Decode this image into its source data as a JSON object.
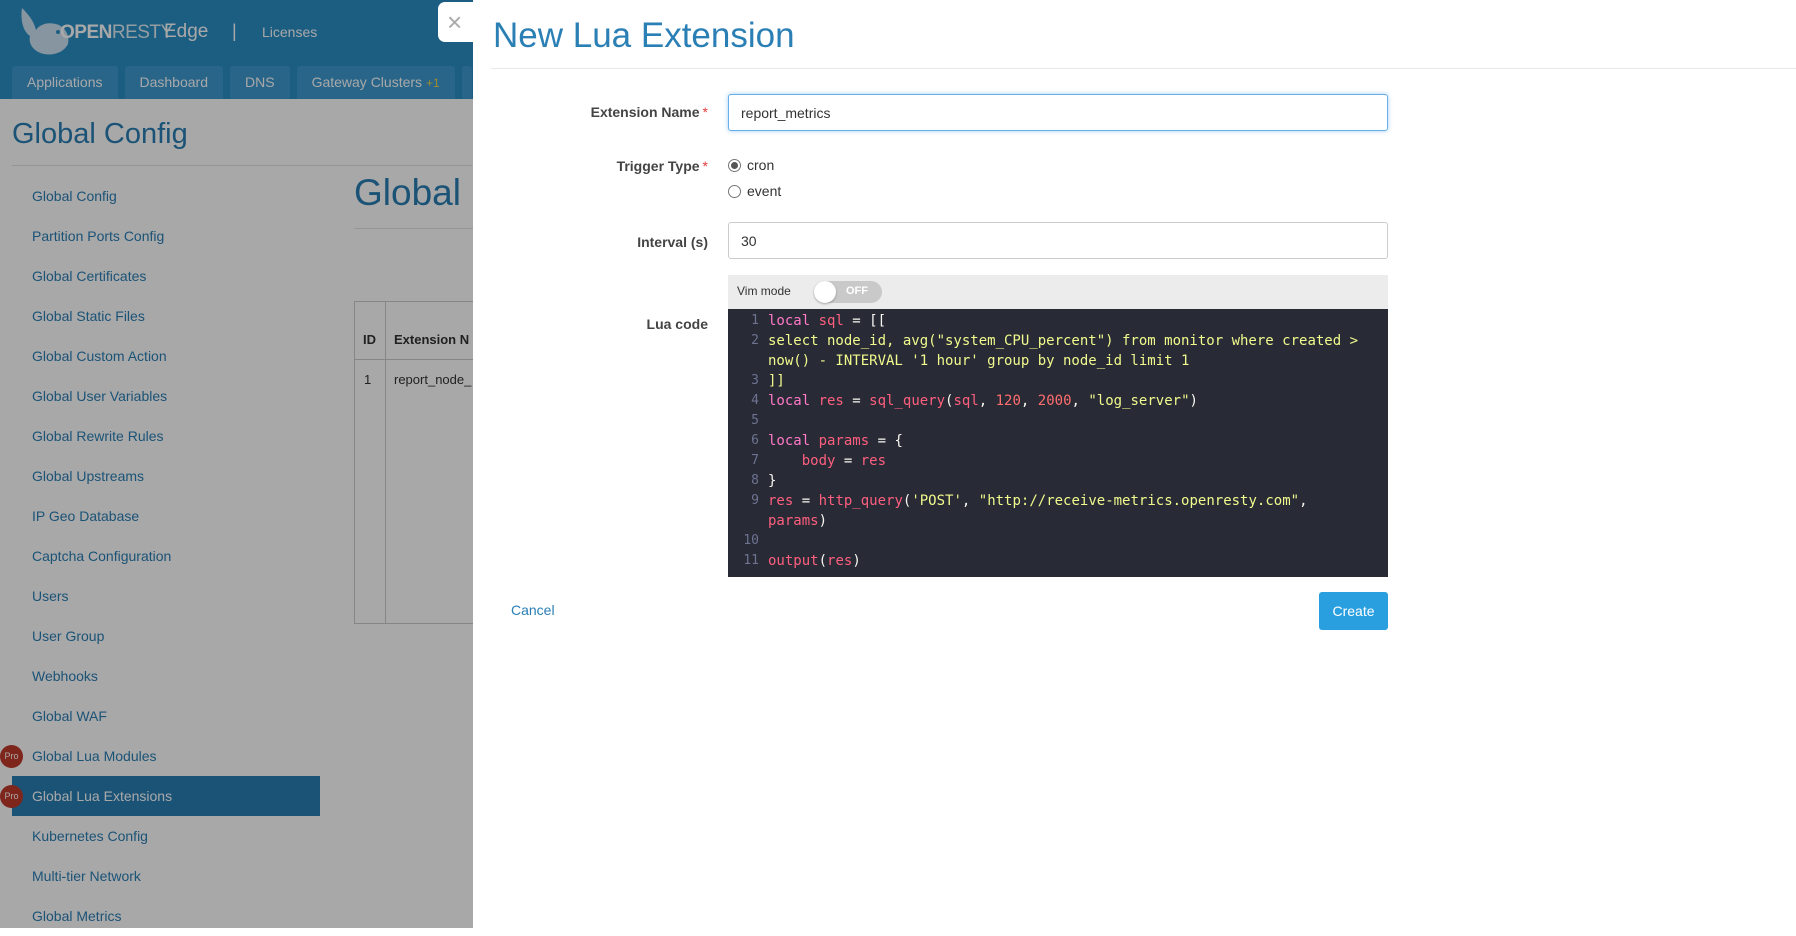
{
  "header": {
    "logo_bold": "OPEN",
    "logo_light": "RESTY",
    "product": "Edge",
    "separator": "|",
    "licenses_link": "Licenses"
  },
  "nav": {
    "tabs": [
      {
        "label": "Applications"
      },
      {
        "label": "Dashboard"
      },
      {
        "label": "DNS"
      },
      {
        "label": "Gateway Clusters",
        "badge": "+1"
      }
    ]
  },
  "page": {
    "title": "Global Config",
    "main_title": "Global L"
  },
  "sidebar": {
    "items": [
      {
        "label": "Global Config"
      },
      {
        "label": "Partition Ports Config"
      },
      {
        "label": "Global Certificates"
      },
      {
        "label": "Global Static Files"
      },
      {
        "label": "Global Custom Action"
      },
      {
        "label": "Global User Variables"
      },
      {
        "label": "Global Rewrite Rules"
      },
      {
        "label": "Global Upstreams"
      },
      {
        "label": "IP Geo Database"
      },
      {
        "label": "Captcha Configuration"
      },
      {
        "label": "Users"
      },
      {
        "label": "User Group"
      },
      {
        "label": "Webhooks"
      },
      {
        "label": "Global WAF"
      },
      {
        "label": "Global Lua Modules",
        "badge": "Pro"
      },
      {
        "label": "Global Lua Extensions",
        "badge": "Pro",
        "active": true
      },
      {
        "label": "Kubernetes Config"
      },
      {
        "label": "Multi-tier Network"
      },
      {
        "label": "Global Metrics"
      }
    ]
  },
  "background_table": {
    "col_id": "ID",
    "col_name": "Extension N",
    "row_id": "1",
    "row_name": "report_node_"
  },
  "modal": {
    "close_glyph": "×",
    "title": "New Lua Extension",
    "extension_name_label": "Extension Name",
    "extension_name_value": "report_metrics",
    "trigger_type_label": "Trigger Type",
    "trigger_options": [
      {
        "label": "cron",
        "selected": true
      },
      {
        "label": "event",
        "selected": false
      }
    ],
    "interval_label": "Interval (s)",
    "interval_value": "30",
    "vim_mode_label": "Vim mode",
    "vim_toggle_state": "OFF",
    "lua_code_label": "Lua code",
    "cancel_label": "Cancel",
    "create_label": "Create",
    "required_mark": "*"
  },
  "code_lines": [
    {
      "n": "1",
      "t": [
        [
          "kw",
          "local "
        ],
        [
          "vr",
          "sql"
        ],
        [
          "tx",
          " = [["
        ]
      ]
    },
    {
      "n": "2",
      "t": [
        [
          "st",
          "select node_id, avg(\"system_CPU_percent\") from monitor where created >"
        ]
      ]
    },
    {
      "n": "",
      "t": [
        [
          "st",
          "now() - INTERVAL '1 hour' group by node_id limit 1"
        ]
      ]
    },
    {
      "n": "3",
      "t": [
        [
          "st",
          "]]"
        ]
      ]
    },
    {
      "n": "4",
      "t": [
        [
          "kw",
          "local "
        ],
        [
          "vr",
          "res"
        ],
        [
          "tx",
          " = "
        ],
        [
          "fn",
          "sql_query"
        ],
        [
          "tx",
          "("
        ],
        [
          "vr",
          "sql"
        ],
        [
          "tx",
          ", "
        ],
        [
          "nm",
          "120"
        ],
        [
          "tx",
          ", "
        ],
        [
          "nm",
          "2000"
        ],
        [
          "tx",
          ", "
        ],
        [
          "st",
          "\"log_server\""
        ],
        [
          "tx",
          ")"
        ]
      ]
    },
    {
      "n": "5",
      "t": []
    },
    {
      "n": "6",
      "t": [
        [
          "kw",
          "local "
        ],
        [
          "vr",
          "params"
        ],
        [
          "tx",
          " = {"
        ]
      ]
    },
    {
      "n": "7",
      "t": [
        [
          "tx",
          "    "
        ],
        [
          "vr",
          "body"
        ],
        [
          "tx",
          " = "
        ],
        [
          "vr",
          "res"
        ]
      ]
    },
    {
      "n": "8",
      "t": [
        [
          "tx",
          "}"
        ]
      ]
    },
    {
      "n": "9",
      "t": [
        [
          "vr",
          "res"
        ],
        [
          "tx",
          " = "
        ],
        [
          "fn",
          "http_query"
        ],
        [
          "tx",
          "("
        ],
        [
          "st",
          "'POST'"
        ],
        [
          "tx",
          ", "
        ],
        [
          "st",
          "\"http://receive-metrics.openresty.com\""
        ],
        [
          "tx",
          ","
        ]
      ]
    },
    {
      "n": "",
      "t": [
        [
          "vr",
          "params"
        ],
        [
          "tx",
          ")"
        ]
      ]
    },
    {
      "n": "10",
      "t": []
    },
    {
      "n": "11",
      "t": [
        [
          "fn",
          "output"
        ],
        [
          "tx",
          "("
        ],
        [
          "vr",
          "res"
        ],
        [
          "tx",
          ")"
        ]
      ]
    }
  ],
  "colors": {
    "header_bg": "#2b8fc6",
    "accent": "#2a7fb5",
    "primary_button": "#2a9fe0",
    "pro_badge": "#c0392b",
    "editor_bg": "#282a36"
  }
}
